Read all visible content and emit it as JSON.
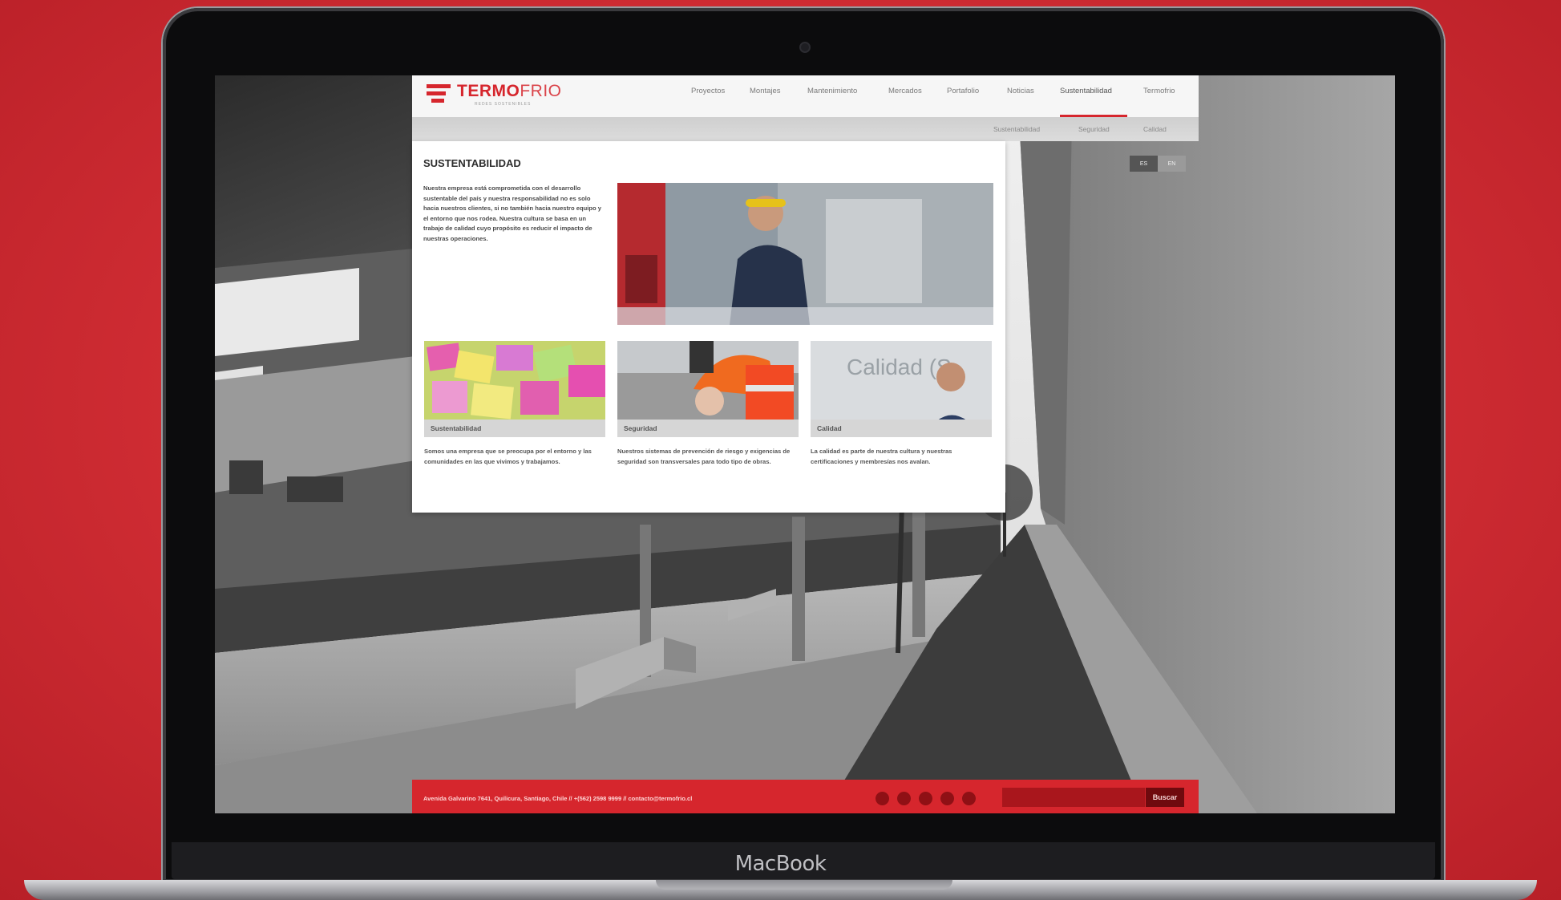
{
  "device": {
    "brand": "MacBook"
  },
  "site": {
    "logo": {
      "name_part1": "TERMO",
      "name_part2": "FRIO",
      "tagline": "REDES SOSTENIBLES"
    },
    "nav": [
      "Proyectos",
      "Montajes",
      "Mantenimiento",
      "Mercados",
      "Portafolio",
      "Noticias",
      "Sustentabilidad",
      "Termofrio"
    ],
    "active_nav": "Sustentabilidad",
    "subnav": [
      "Sustentabilidad",
      "Seguridad",
      "Calidad"
    ],
    "language": {
      "es": "ES",
      "en": "EN"
    },
    "title": "SUSTENTABILIDAD",
    "intro": "Nuestra empresa está comprometida con el desarrollo sustentable del país y nuestra responsabilidad no es solo hacia nuestros clientes, si no también hacia nuestro equipo y el entorno que nos rodea. Nuestra cultura se basa en un trabajo de calidad cuyo propósito es reducir el impacto de nuestras operaciones.",
    "cards": [
      {
        "label": "Sustentabilidad",
        "desc": "Somos una empresa que se preocupa por el entorno y las comunidades en las que vivimos y trabajamos."
      },
      {
        "label": "Seguridad",
        "desc": "Nuestros sistemas de prevención de riesgo y exigencias de seguridad son transversales para todo tipo de obras."
      },
      {
        "label": "Calidad",
        "desc": "La calidad es parte de nuestra cultura y nuestras certificaciones y membresías nos avalan.",
        "image_caption": "Calidad (S"
      }
    ],
    "footer": {
      "address": "Avenida Galvarino 7641, Quilicura, Santiago, Chile // +(562) 2598 9999 // contacto@termofrio.cl",
      "social_icons": [
        "linkedin-icon",
        "facebook-icon",
        "twitter-icon",
        "youtube-icon",
        "flickr-icon"
      ],
      "search_button": "Buscar"
    },
    "colors": {
      "brand_red": "#d6262d"
    }
  }
}
